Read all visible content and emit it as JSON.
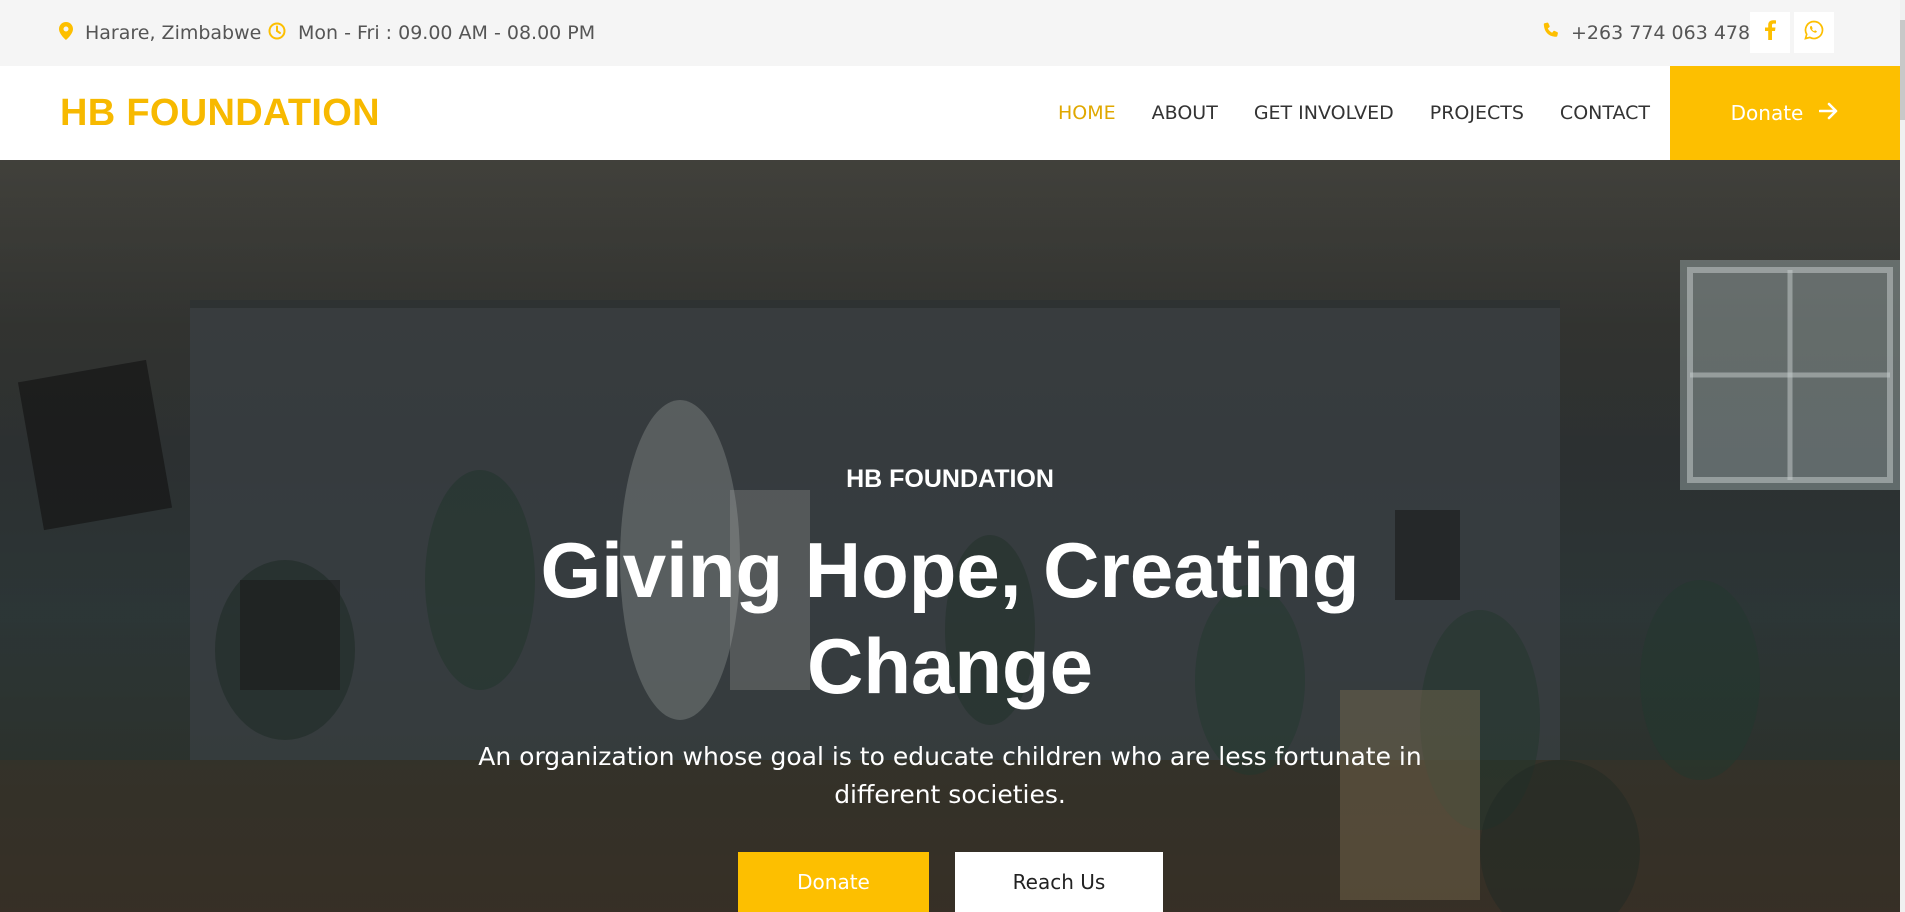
{
  "topbar": {
    "location": "Harare, Zimbabwe",
    "hours": "Mon - Fri : 09.00 AM - 08.00 PM",
    "phone": "+263 774 063 478",
    "social": [
      "facebook-icon",
      "whatsapp-icon"
    ]
  },
  "navbar": {
    "logo": "HB FOUNDATION",
    "links": [
      "HOME",
      "ABOUT",
      "GET INVOLVED",
      "PROJECTS",
      "CONTACT"
    ],
    "active_link": "HOME",
    "donate_label": "Donate"
  },
  "hero": {
    "subtitle": "HB FOUNDATION",
    "title": "Giving Hope, Creating Change",
    "description": "An organization whose goal is to educate children who are less fortunate in different societies.",
    "donate_label": "Donate",
    "reach_label": "Reach Us"
  },
  "colors": {
    "accent": "#fdbf00",
    "topbar_bg": "#f5f5f5",
    "text_dark": "#333333"
  }
}
